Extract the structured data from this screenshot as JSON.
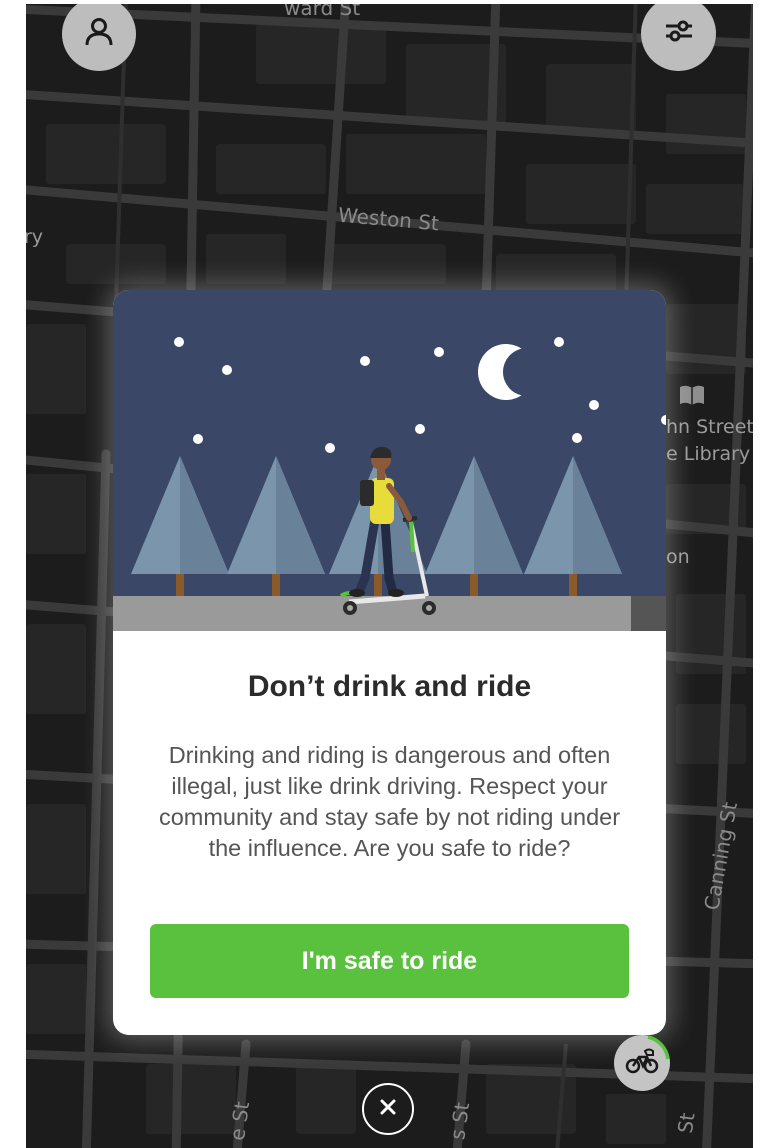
{
  "map": {
    "streets": [
      "ward St",
      "Weston St",
      "Canning St",
      "e St",
      "s St",
      "St"
    ],
    "pois": [
      "ry",
      "hn Street",
      "e Library",
      "on"
    ]
  },
  "top_bar": {
    "profile_icon": "person-icon",
    "filter_icon": "sliders-icon"
  },
  "modal": {
    "title": "Don’t drink and ride",
    "body": "Drinking and riding is dangerous and often illegal, just like drink driving. Respect your community and stay safe by not riding under the influence. Are you safe to ride?",
    "button_label": "I'm safe to ride"
  },
  "bottom": {
    "vehicle_icon": "bicycle-icon",
    "close_icon": "close-icon"
  },
  "colors": {
    "accent_green": "#5ac13e",
    "night_sky": "#3a4766",
    "map_background": "#1c1c1c"
  }
}
